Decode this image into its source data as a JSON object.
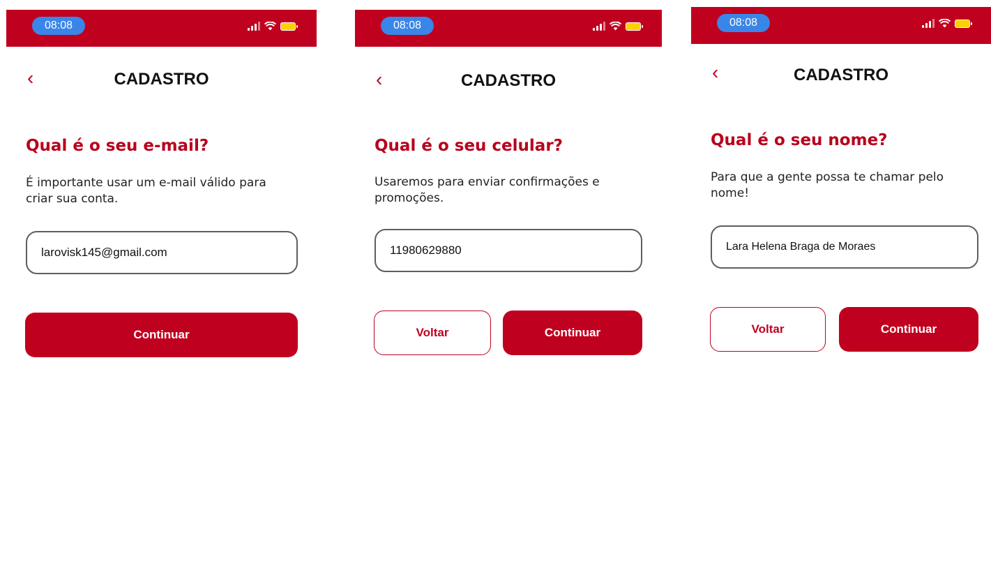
{
  "screens": [
    {
      "status": {
        "time": "08:08"
      },
      "header": {
        "back_icon": "chevron-left-icon",
        "title": "CADASTRO"
      },
      "question": "Qual é o seu e-mail?",
      "subtitle": "É importante usar um e-mail válido para criar sua conta.",
      "input": {
        "value": "larovisk145@gmail.com"
      },
      "buttons": {
        "continue_label": "Continuar"
      }
    },
    {
      "status": {
        "time": "08:08"
      },
      "header": {
        "back_icon": "chevron-left-icon",
        "title": "CADASTRO"
      },
      "question": "Qual é o seu celular?",
      "subtitle": "Usaremos para enviar confirmações e promoções.",
      "input": {
        "value": "11980629880"
      },
      "buttons": {
        "back_label": "Voltar",
        "continue_label": "Continuar"
      }
    },
    {
      "status": {
        "time": "08:08"
      },
      "header": {
        "back_icon": "chevron-left-icon",
        "title": "CADASTRO"
      },
      "question": "Qual é o seu nome?",
      "subtitle": "Para que a gente possa te chamar pelo nome!",
      "input": {
        "value": "Lara Helena Braga de Moraes"
      },
      "buttons": {
        "back_label": "Voltar",
        "continue_label": "Continuar"
      }
    }
  ],
  "colors": {
    "brand": "#c0001f",
    "time_pill": "#3a86e8",
    "battery": "#ffd000"
  },
  "icons": {
    "signal": "cellular-signal-icon",
    "wifi": "wifi-icon",
    "battery": "battery-icon"
  }
}
